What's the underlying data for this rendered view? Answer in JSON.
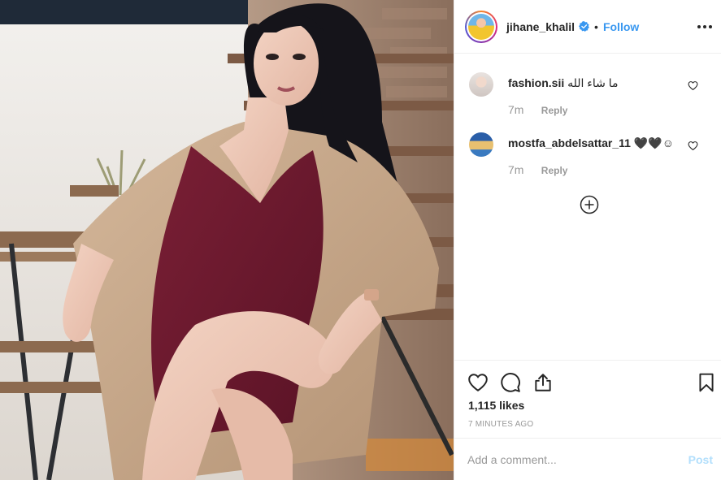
{
  "post": {
    "username": "jihane_khalil",
    "separator": "•",
    "follow_label": "Follow"
  },
  "comments": [
    {
      "username": "fashion.sii",
      "text": "ما شاء الله",
      "time": "7m",
      "reply_label": "Reply"
    },
    {
      "username": "mostfa_abdelsattar_11",
      "text": "🖤🖤☺",
      "time": "7m",
      "reply_label": "Reply"
    }
  ],
  "actions": {
    "likes": "1,115 likes",
    "posted": "7 MINUTES AGO"
  },
  "composer": {
    "placeholder": "Add a comment...",
    "post_label": "Post"
  },
  "icons": {
    "verified": "verified-badge-icon",
    "more": "more-options-icon",
    "like": "heart-icon",
    "comment": "comment-icon",
    "share": "share-icon",
    "save": "bookmark-icon",
    "load_more": "plus-circle-icon"
  },
  "colors": {
    "accent": "#3897f0",
    "post_disabled": "#b2dffc",
    "muted": "#999999",
    "text": "#262626"
  }
}
